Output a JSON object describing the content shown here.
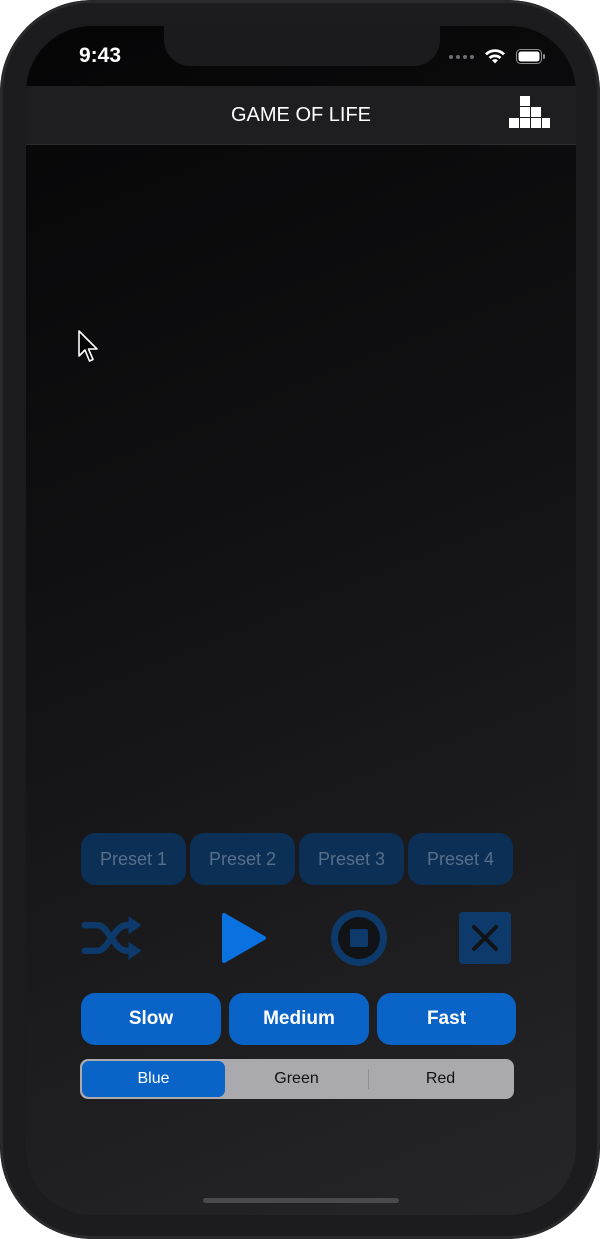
{
  "status_bar": {
    "time": "9:43"
  },
  "nav": {
    "title": "GAME OF LIFE",
    "icon": "staircase-blocks-icon"
  },
  "presets": [
    {
      "label": "Preset 1"
    },
    {
      "label": "Preset 2"
    },
    {
      "label": "Preset 3"
    },
    {
      "label": "Preset 4"
    }
  ],
  "controls": [
    {
      "name": "shuffle-icon"
    },
    {
      "name": "play-icon"
    },
    {
      "name": "stop-icon"
    },
    {
      "name": "clear-icon"
    }
  ],
  "speeds": [
    {
      "label": "Slow"
    },
    {
      "label": "Medium"
    },
    {
      "label": "Fast"
    }
  ],
  "colors_segment": {
    "options": [
      {
        "label": "Blue"
      },
      {
        "label": "Green"
      },
      {
        "label": "Red"
      }
    ],
    "selected": "Blue"
  },
  "theme": {
    "accent": "#0a64c8",
    "preset_bg": "#0b2f55",
    "background": "#1b1b1d"
  }
}
